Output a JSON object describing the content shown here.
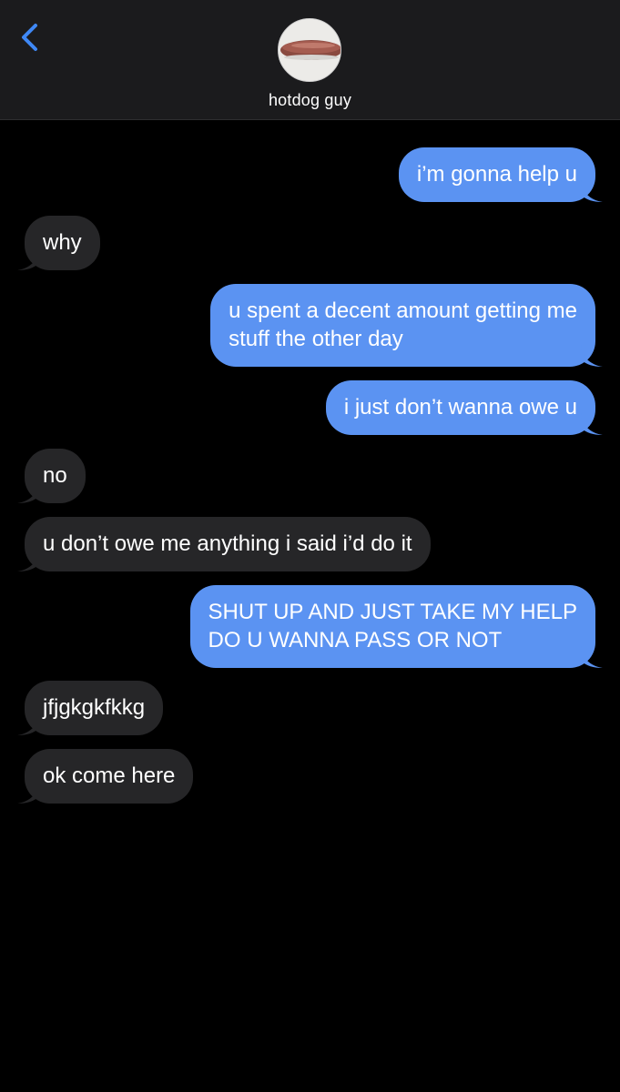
{
  "header": {
    "contact_name": "hotdog guy",
    "back_icon": "chevron-left-icon",
    "avatar": "hotdog-photo"
  },
  "colors": {
    "sent_bubble": "#5b93f2",
    "received_bubble": "#262628",
    "accent": "#3f88f6",
    "background": "#000000"
  },
  "messages": [
    {
      "from": "me",
      "lines": [
        "i’m gonna help u"
      ]
    },
    {
      "from": "them",
      "lines": [
        "why"
      ]
    },
    {
      "from": "me",
      "lines": [
        "u spent a decent amount getting me",
        "stuff the other day"
      ]
    },
    {
      "from": "me",
      "lines": [
        "i just don’t wanna owe u"
      ]
    },
    {
      "from": "them",
      "lines": [
        "no"
      ]
    },
    {
      "from": "them",
      "lines": [
        "u don’t owe me anything i said i’d do it"
      ]
    },
    {
      "from": "me",
      "lines": [
        "SHUT UP AND JUST TAKE MY HELP",
        "DO U WANNA PASS OR NOT"
      ]
    },
    {
      "from": "them",
      "lines": [
        "jfjgkgkfkkg"
      ]
    },
    {
      "from": "them",
      "lines": [
        "ok come here"
      ]
    }
  ]
}
